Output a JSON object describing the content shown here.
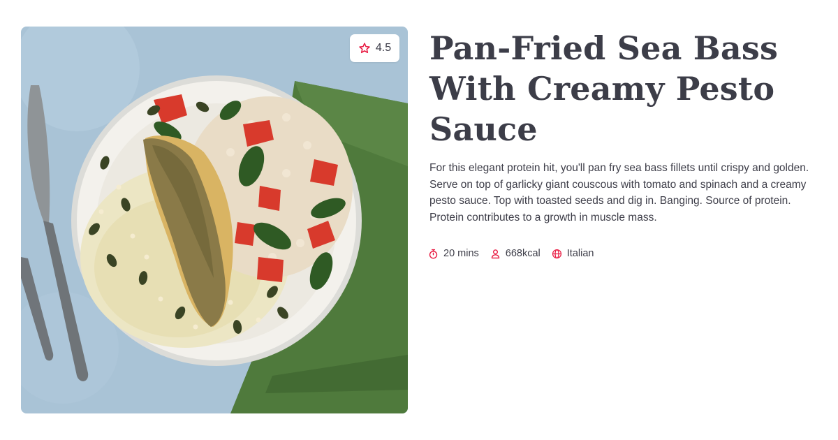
{
  "recipe": {
    "title": "Pan-Fried Sea Bass With Creamy Pesto Sauce",
    "description": "For this elegant protein hit, you'll pan fry sea bass fillets until crispy and golden. Serve on top of garlicky giant couscous with tomato and spinach and a creamy pesto sauce. Top with toasted seeds and dig in. Banging. Source of protein. Protein contributes to a growth in muscle mass.",
    "rating": "4.5",
    "rating_icon": "star-outline-icon",
    "meta": {
      "time": "20 mins",
      "calories": "668kcal",
      "cuisine": "Italian"
    },
    "image_alt": "Pan-fried sea bass on a plate with pesto sauce, giant couscous, tomato and spinach"
  },
  "colors": {
    "accent": "#e8173f",
    "title_text": "#3c3d48",
    "body_text": "#3d3d48",
    "background": "#ffffff"
  }
}
